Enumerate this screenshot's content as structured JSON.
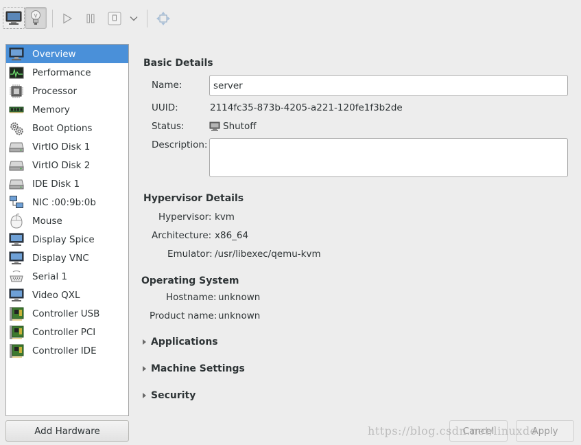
{
  "toolbar": {
    "console_icon": "monitor-icon",
    "details_icon": "lightbulb-icon",
    "run_icon": "play-icon",
    "pause_icon": "pause-icon",
    "shutdown_icon": "power-icon",
    "shutdown_menu_icon": "chevron-down-icon",
    "fullscreen_icon": "fullscreen-icon"
  },
  "sidebar": {
    "items": [
      {
        "label": "Overview",
        "icon": "monitor-icon",
        "selected": true
      },
      {
        "label": "Performance",
        "icon": "performance-graph-icon"
      },
      {
        "label": "Processor",
        "icon": "cpu-chip-icon"
      },
      {
        "label": "Memory",
        "icon": "memory-stick-icon"
      },
      {
        "label": "Boot Options",
        "icon": "gears-icon"
      },
      {
        "label": "VirtIO Disk 1",
        "icon": "harddisk-icon"
      },
      {
        "label": "VirtIO Disk 2",
        "icon": "harddisk-icon"
      },
      {
        "label": "IDE Disk 1",
        "icon": "harddisk-icon"
      },
      {
        "label": "NIC :00:9b:0b",
        "icon": "network-icon"
      },
      {
        "label": "Mouse",
        "icon": "mouse-icon"
      },
      {
        "label": "Display Spice",
        "icon": "monitor-icon"
      },
      {
        "label": "Display VNC",
        "icon": "monitor-icon"
      },
      {
        "label": "Serial 1",
        "icon": "serial-port-icon"
      },
      {
        "label": "Video QXL",
        "icon": "monitor-icon"
      },
      {
        "label": "Controller USB",
        "icon": "pci-card-icon"
      },
      {
        "label": "Controller PCI",
        "icon": "pci-card-icon"
      },
      {
        "label": "Controller IDE",
        "icon": "pci-card-icon"
      }
    ]
  },
  "buttons": {
    "add_hardware": "Add Hardware",
    "cancel": "Cancel",
    "apply": "Apply"
  },
  "basic": {
    "title": "Basic Details",
    "name_label": "Name:",
    "name_value": "server",
    "uuid_label": "UUID:",
    "uuid_value": "2114fc35-873b-4205-a221-120fe1f3b2de",
    "status_label": "Status:",
    "status_value": "Shutoff",
    "description_label": "Description:",
    "description_value": ""
  },
  "hypervisor": {
    "title": "Hypervisor Details",
    "hypervisor_label": "Hypervisor:",
    "hypervisor_value": "kvm",
    "arch_label": "Architecture:",
    "arch_value": "x86_64",
    "emulator_label": "Emulator:",
    "emulator_value": "/usr/libexec/qemu-kvm"
  },
  "os": {
    "title": "Operating System",
    "hostname_label": "Hostname:",
    "hostname_value": "unknown",
    "product_label": "Product name:",
    "product_value": "unknown"
  },
  "expanders": {
    "applications": "Applications",
    "machine_settings": "Machine Settings",
    "security": "Security"
  },
  "watermark": "https://blog.csdn.net/linuxde",
  "colors": {
    "selection": "#4a90d9",
    "background": "#ededed"
  }
}
